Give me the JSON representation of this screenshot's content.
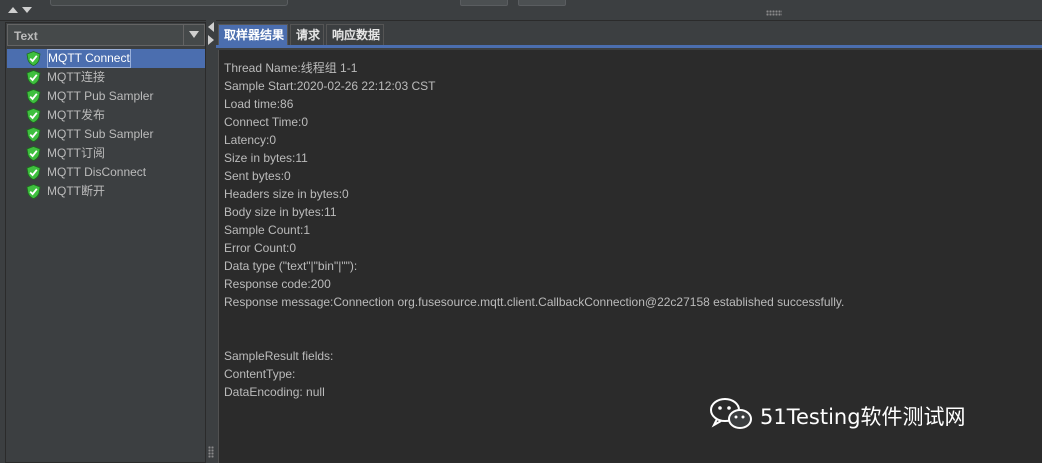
{
  "renderer": {
    "selected": "Text"
  },
  "tree": {
    "items": [
      {
        "label": "MQTT Connect",
        "selected": true
      },
      {
        "label": "MQTT连接"
      },
      {
        "label": "MQTT Pub Sampler"
      },
      {
        "label": "MQTT发布"
      },
      {
        "label": "MQTT Sub Sampler"
      },
      {
        "label": "MQTT订阅"
      },
      {
        "label": "MQTT DisConnect"
      },
      {
        "label": "MQTT断开"
      }
    ]
  },
  "tabs": [
    {
      "label": "取样器结果",
      "active": true
    },
    {
      "label": "请求"
    },
    {
      "label": "响应数据"
    }
  ],
  "result": {
    "lines": [
      "Thread Name:线程组 1-1",
      "Sample Start:2020-02-26 22:12:03 CST",
      "Load time:86",
      "Connect Time:0",
      "Latency:0",
      "Size in bytes:11",
      "Sent bytes:0",
      "Headers size in bytes:0",
      "Body size in bytes:11",
      "Sample Count:1",
      "Error Count:0",
      "Data type (\"text\"|\"bin\"|\"\"):",
      "Response code:200",
      "Response message:Connection org.fusesource.mqtt.client.CallbackConnection@22c27158 established successfully.",
      "",
      "",
      "SampleResult fields:",
      "ContentType:",
      "DataEncoding: null"
    ]
  },
  "watermark": {
    "text": "51Testing软件测试网"
  },
  "colors": {
    "selection": "#4b6eaf",
    "background": "#3c3f41",
    "content": "#2b2b2b",
    "ok": "#3fbf3f"
  }
}
